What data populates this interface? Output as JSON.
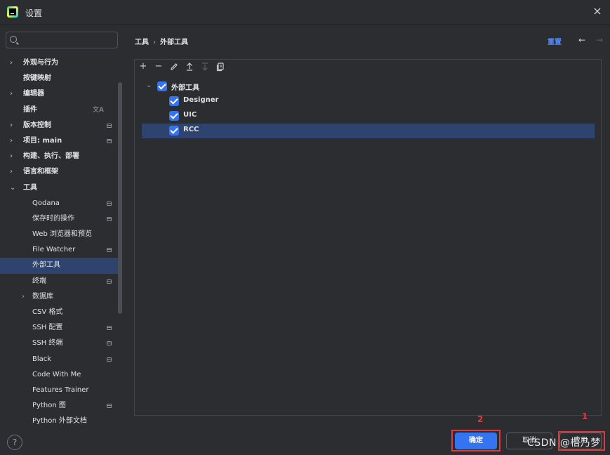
{
  "window": {
    "title": "设置",
    "close_label": "×"
  },
  "search": {
    "placeholder": "",
    "value": ""
  },
  "sidebar": {
    "items": [
      {
        "label": "外观与行为",
        "chevron": "›",
        "bold": true
      },
      {
        "label": "按键映射",
        "bold": true
      },
      {
        "label": "编辑器",
        "chevron": "›",
        "bold": true
      },
      {
        "label": "插件",
        "bold": true,
        "extra": "文A"
      },
      {
        "label": "版本控制",
        "chevron": "›",
        "bold": true,
        "mark": true
      },
      {
        "label": "项目: main",
        "chevron": "›",
        "bold": true,
        "mark": true
      },
      {
        "label": "构建、执行、部署",
        "chevron": "›",
        "bold": true
      },
      {
        "label": "语言和框架",
        "chevron": "›",
        "bold": true
      },
      {
        "label": "工具",
        "chevron": "⌄",
        "bold": true
      },
      {
        "label": "Qodana",
        "level": 1,
        "mark": true
      },
      {
        "label": "保存时的操作",
        "level": 1,
        "mark": true
      },
      {
        "label": "Web 浏览器和预览",
        "level": 1
      },
      {
        "label": "File Watcher",
        "level": 1,
        "mark": true
      },
      {
        "label": "外部工具",
        "level": 1,
        "selected": true
      },
      {
        "label": "终端",
        "level": 1,
        "mark": true
      },
      {
        "label": "数据库",
        "level": 1,
        "chevron": "›"
      },
      {
        "label": "CSV 格式",
        "level": 1
      },
      {
        "label": "SSH 配置",
        "level": 1,
        "mark": true
      },
      {
        "label": "SSH 终端",
        "level": 1,
        "mark": true
      },
      {
        "label": "Black",
        "level": 1,
        "mark": true
      },
      {
        "label": "Code With Me",
        "level": 1
      },
      {
        "label": "Features Trainer",
        "level": 1
      },
      {
        "label": "Python 图",
        "level": 1,
        "mark": true
      },
      {
        "label": "Python 外部文档",
        "level": 1
      }
    ]
  },
  "breadcrumb": {
    "parent": "工具",
    "separator": "›",
    "current": "外部工具"
  },
  "header": {
    "reset_label": "重置",
    "back_label": "←",
    "forward_label": "→"
  },
  "toolbar": {
    "add": "+",
    "remove": "−"
  },
  "tools_tree": {
    "group": {
      "label": "外部工具",
      "checked": true,
      "chevron": "⌄"
    },
    "items": [
      {
        "label": "Designer",
        "checked": true
      },
      {
        "label": "UIC",
        "checked": true
      },
      {
        "label": "RCC",
        "checked": true,
        "selected": true
      }
    ]
  },
  "footer": {
    "help_label": "?",
    "ok_label": "确定",
    "cancel_label": "取消",
    "apply_label": "应用"
  },
  "annotations": {
    "ok_number": "2",
    "apply_number": "1"
  },
  "watermark": "CSDN @梧乃梦",
  "colors": {
    "accent": "#3574f0",
    "selection": "#2e436e",
    "annotation": "#e0393e",
    "link": "#548af7"
  }
}
